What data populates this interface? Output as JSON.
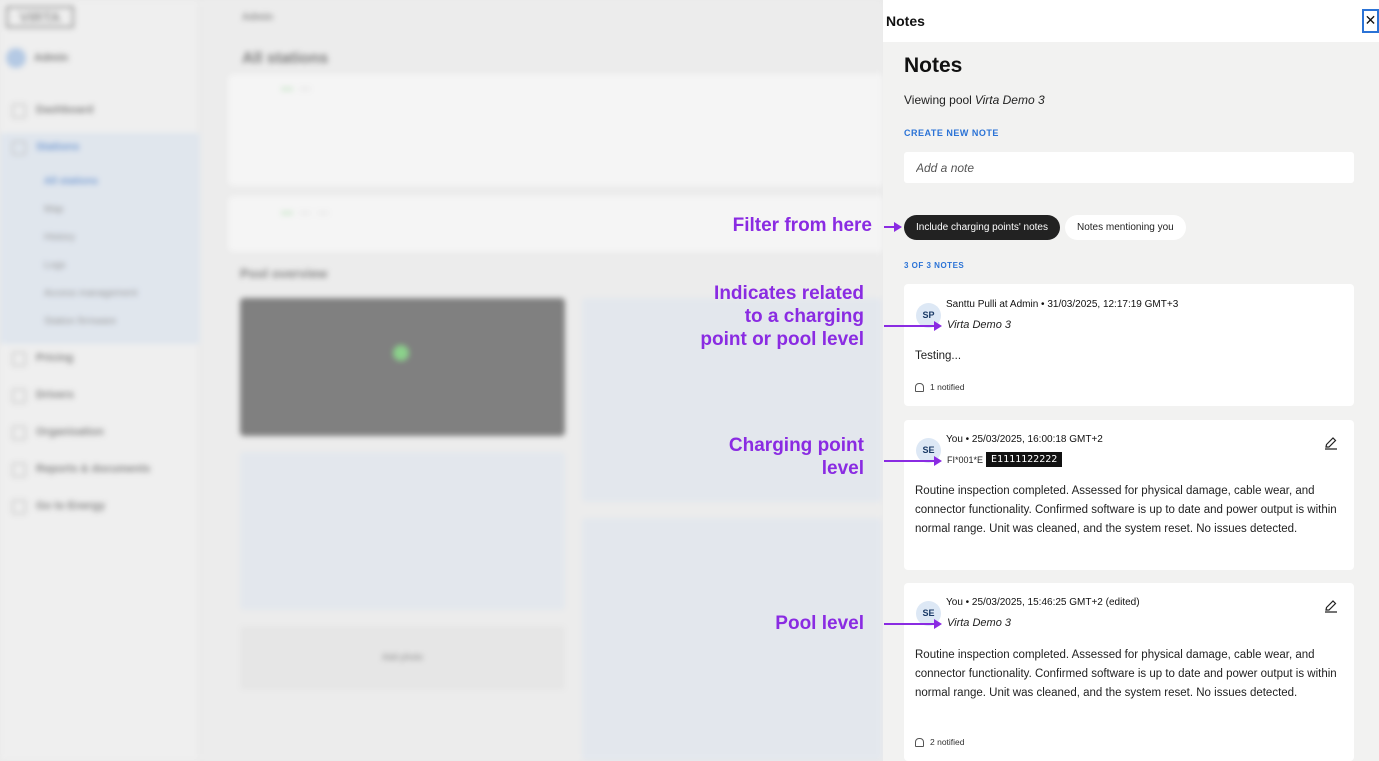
{
  "panel": {
    "topbar_title": "Notes",
    "close_label": "✕",
    "heading": "Notes",
    "viewing_prefix": "Viewing pool",
    "viewing_pool": "Virta Demo 3",
    "create_label": "CREATE NEW NOTE",
    "input_placeholder": "Add a note",
    "filters": [
      {
        "label": "Include charging points' notes",
        "active": true
      },
      {
        "label": "Notes mentioning you",
        "active": false
      }
    ],
    "count": "3 OF 3 NOTES",
    "notes": [
      {
        "initials": "SP",
        "meta": "Santtu Pulli at Admin • 31/03/2025, 12:17:19 GMT+3",
        "ref": "Virta Demo 3",
        "body": "Testing...",
        "notified": "1 notified"
      },
      {
        "initials": "SE",
        "meta": "You • 25/03/2025, 16:00:18 GMT+2",
        "ref_prefix": "FI*001*E",
        "ref_evse": "E1111122222",
        "body": "Routine inspection completed. Assessed for physical damage, cable wear, and connector functionality. Confirmed software is up to date and power output is within normal range. Unit was cleaned, and the system reset. No issues detected."
      },
      {
        "initials": "SE",
        "meta": "You • 25/03/2025, 15:46:25 GMT+2 (edited)",
        "ref": "Virta Demo 3",
        "body": "Routine inspection completed. Assessed for physical damage, cable wear, and connector functionality. Confirmed software is up to date and power output is within normal range. Unit was cleaned, and the system reset. No issues detected.",
        "notified": "2 notified"
      }
    ]
  },
  "annotations": {
    "filter": "Filter from here",
    "indicates": "Indicates related to a charging point or pool level",
    "charging_point": "Charging point level",
    "pool": "Pool level"
  },
  "colors": {
    "annotation": "#8a2be2",
    "accent": "#2b73d6",
    "panel_bg": "#f2f2f1"
  },
  "background": {
    "breadcrumb": "Admin",
    "page_title": "All stations",
    "user": "Admin",
    "nav": [
      "Dashboard",
      "Stations",
      "Pricing",
      "Drivers",
      "Organisation",
      "Reports & documents",
      "Go to Energy"
    ],
    "stations_sub": [
      "All stations",
      "Map",
      "History",
      "Logs",
      "Access management",
      "Station firmware"
    ],
    "pool_overview": "Pool overview",
    "add_photo": "Add photo"
  }
}
